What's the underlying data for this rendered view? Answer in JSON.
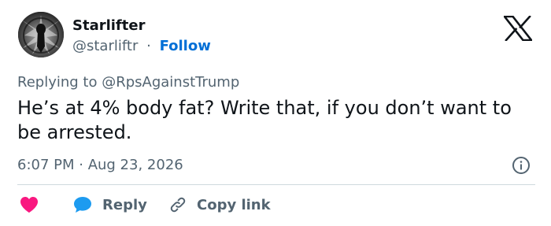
{
  "author": {
    "name": "Starlifter",
    "handle": "@starliftr",
    "separator": "·",
    "follow_label": "Follow"
  },
  "reply_context": {
    "text": "Replying to @RpsAgainstTrump"
  },
  "tweet": {
    "text": "He’s at 4% body fat? Write that, if you don’t want to be arrested."
  },
  "meta": {
    "timestamp": "6:07 PM · Aug 23, 2026"
  },
  "actions": {
    "reply_label": "Reply",
    "copy_link_label": "Copy link"
  },
  "icons": {
    "logo": "x-logo-icon",
    "info": "info-icon",
    "like": "heart-icon",
    "reply": "speech-bubble-icon",
    "copy": "link-icon"
  },
  "colors": {
    "text_primary": "#0f1419",
    "text_secondary": "#536471",
    "follow_link": "#006fd6",
    "heart": "#f91880",
    "reply_bubble": "#1d9bf0",
    "divider": "#cfd9de"
  }
}
